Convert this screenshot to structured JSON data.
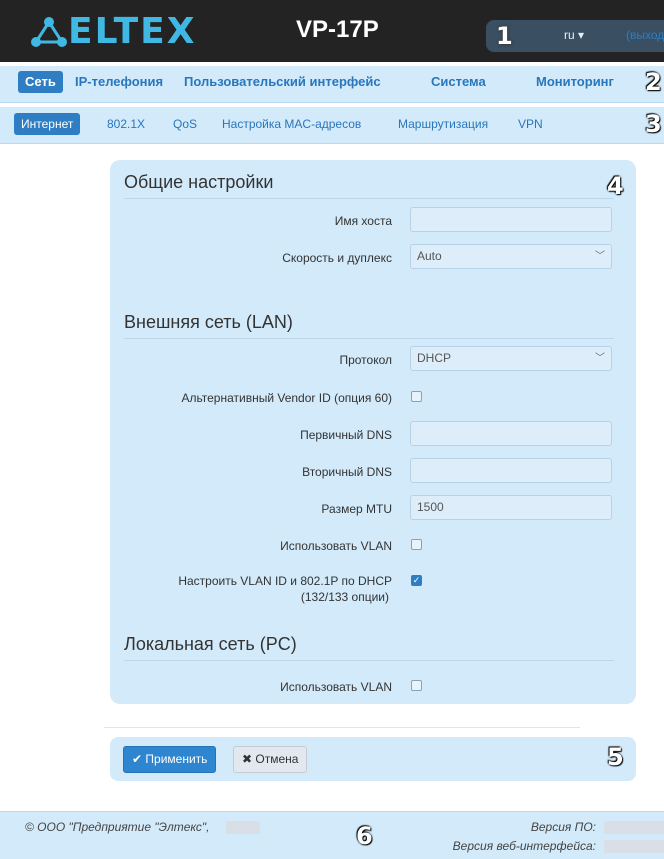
{
  "header": {
    "logo_text": "ELTEX",
    "device": "VP-17P",
    "lang": "ru ▾",
    "logout": "(выход)"
  },
  "badges": [
    "1",
    "2",
    "3",
    "4",
    "5",
    "6"
  ],
  "nav_main": [
    "Сеть",
    "IP-телефония",
    "Пользовательский интерфейс",
    "Система",
    "Мониторинг"
  ],
  "nav_sub": [
    "Интернет",
    "802.1X",
    "QoS",
    "Настройка MAC-адресов",
    "Маршрутизация",
    "VPN"
  ],
  "general": {
    "title": "Общие настройки",
    "hostname_label": "Имя хоста",
    "hostname_value": "",
    "speed_label": "Скорость и дуплекс",
    "speed_value": "Auto"
  },
  "lan": {
    "title": "Внешняя сеть (LAN)",
    "protocol_label": "Протокол",
    "protocol_value": "DHCP",
    "vendor_label": "Альтернативный Vendor ID (опция 60)",
    "dns1_label": "Первичный DNS",
    "dns2_label": "Вторичный DNS",
    "mtu_label": "Размер MTU",
    "mtu_value": "1500",
    "vlan_label": "Использовать VLAN",
    "vlan_dhcp_label_1": "Настроить VLAN ID и 802.1P по DHCP",
    "vlan_dhcp_label_2": "(132/133 опции)"
  },
  "pc": {
    "title": "Локальная сеть (PC)",
    "vlan_label": "Использовать VLAN"
  },
  "actions": {
    "apply": "✔ Применить",
    "cancel": "✖ Отмена"
  },
  "footer": {
    "copyright": "© ООО \"Предприятие \"Элтекс\",",
    "fw_label": "Версия ПО:",
    "web_label": "Версия веб-интерфейса:"
  },
  "colors": {
    "accent": "#2f7ec4",
    "panel": "#d2eafa",
    "header": "#232323",
    "logo": "#3fb9e4"
  }
}
